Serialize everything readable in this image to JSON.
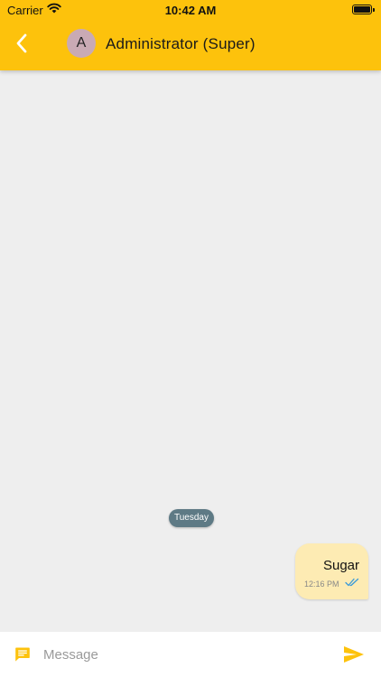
{
  "status_bar": {
    "carrier": "Carrier",
    "time": "10:42 AM"
  },
  "app_bar": {
    "avatar_initial": "A",
    "title": "Administrator (Super)",
    "back_icon": "chevron-left-icon"
  },
  "chat": {
    "day_separator": "Tuesday",
    "messages": [
      {
        "text": "Sugar",
        "time": "12:16 PM",
        "status_icon": "double-check-icon",
        "outgoing": true
      }
    ]
  },
  "composer": {
    "placeholder": "Message",
    "value": "",
    "left_icon": "message-icon",
    "send_icon": "send-icon"
  },
  "colors": {
    "accent": "#fdc20c",
    "outgoing_bubble": "#fdebb3",
    "day_chip": "#5e7a85",
    "ticks": "#3a9ad9",
    "background": "#eeeeee"
  }
}
